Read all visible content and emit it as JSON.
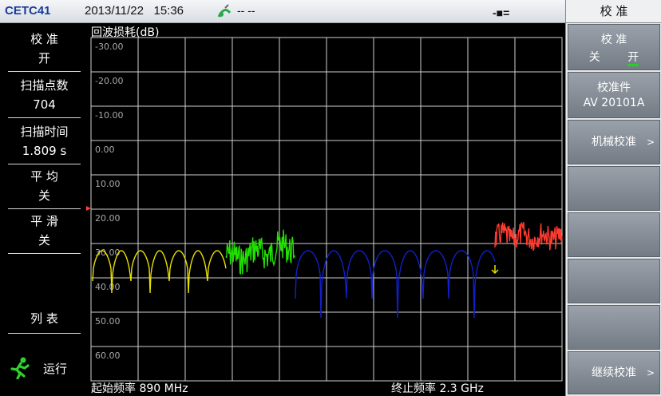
{
  "status_bar": {
    "brand": "CETC41",
    "date": "2013/11/22",
    "time": "15:36",
    "signal_text": "-- --",
    "plug_symbol": "-■="
  },
  "left_panel": {
    "items": [
      {
        "label": "校 准",
        "value": "开"
      },
      {
        "label": "扫描点数",
        "value": "704"
      },
      {
        "label": "扫描时间",
        "value": "1.809 s"
      },
      {
        "label": "平 均",
        "value": "关"
      },
      {
        "label": "平 滑",
        "value": "关"
      }
    ],
    "list_label": "列 表",
    "run_label": "运行"
  },
  "plot": {
    "title": "回波损耗(dB)",
    "y_ticks": [
      "-30.00",
      "-20.00",
      "-10.00",
      "0.00",
      "10.00",
      "20.00",
      "30.00",
      "40.00",
      "50.00",
      "60.00"
    ],
    "start_freq": "起始频率 890 MHz",
    "stop_freq": "终止频率 2.3 GHz"
  },
  "right_panel": {
    "header": "校 准",
    "buttons": [
      {
        "line1": "校 准",
        "opt_off": "关",
        "opt_on": "开"
      },
      {
        "line1": "校准件",
        "line2": "AV 20101A"
      },
      {
        "line1": "机械校准",
        "arrow": ">"
      },
      {
        "line1": ""
      },
      {
        "line1": ""
      },
      {
        "line1": ""
      },
      {
        "line1": ""
      },
      {
        "line1": "继续校准",
        "arrow": ">"
      }
    ]
  },
  "colors": {
    "trace_yellow": "#e8e000",
    "trace_green": "#22e000",
    "trace_blue": "#1020c8",
    "trace_red": "#ff3b30",
    "grid": "#cfcfcf"
  }
}
